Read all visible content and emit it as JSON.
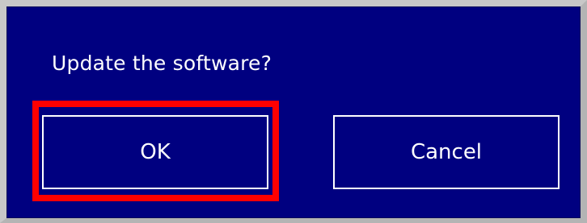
{
  "dialog": {
    "message": "Update the software?",
    "ok_label": "OK",
    "cancel_label": "Cancel"
  },
  "colors": {
    "dialog_background": "#000080",
    "text": "#ffffff",
    "button_border": "#ffffff",
    "focus_highlight": "#ff0000",
    "frame": "#c8c8c8"
  }
}
